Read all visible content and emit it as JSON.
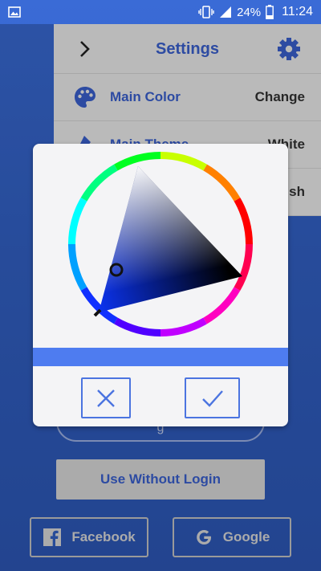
{
  "status_bar": {
    "battery_percent": "24%",
    "time": "11:24",
    "icons": [
      "image-icon",
      "vibrate-icon",
      "signal-icon",
      "battery-icon"
    ]
  },
  "settings": {
    "title": "Settings",
    "rows": [
      {
        "label": "Main Color",
        "value": "Change",
        "icon": "palette-icon"
      },
      {
        "label": "Main Theme",
        "value": "White",
        "icon": "theme-icon"
      },
      {
        "label": "",
        "value": "sh",
        "icon": ""
      }
    ]
  },
  "login": {
    "use_without_login": "Use Without Login",
    "facebook": "Facebook",
    "google": "Google"
  },
  "color_picker": {
    "selected_color": "#4e7cf0",
    "hue_color": "#0b32ea"
  },
  "colors": {
    "accent": "#3a60d0",
    "background": "#2f5ab7",
    "dialog_bg": "#f4f4f6"
  }
}
